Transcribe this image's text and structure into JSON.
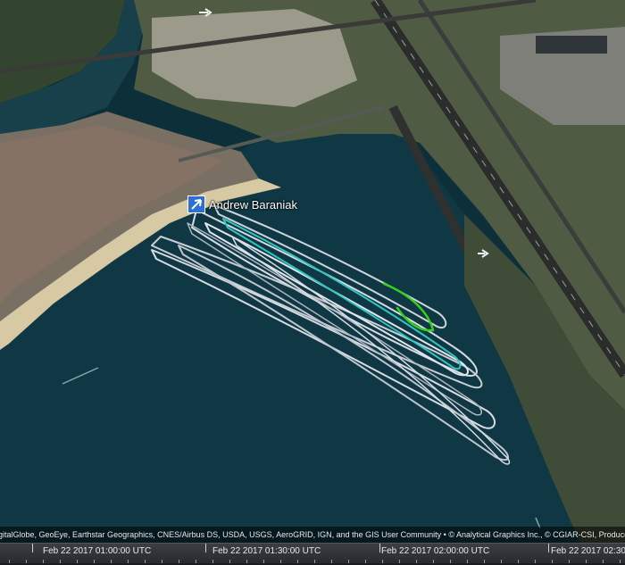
{
  "map": {
    "tracker": {
      "name": "Andrew Baraniak",
      "icon": "user-location-icon",
      "color": "#2d6fd4"
    },
    "track_colors": {
      "primary": "#d7dce3",
      "highlight_cyan": "#30c6c0",
      "highlight_green": "#33d21e"
    }
  },
  "credits": {
    "text": "igitalGlobe, GeoEye, Earthstar Geographics, CNES/Airbus DS, USDA, USGS, AeroGRID, IGN, and the GIS User Community • © Analytical Graphics Inc., © CGIAR-CSI, Produced using Copernicus data"
  },
  "timeline": {
    "labels": [
      "Feb 22 2017 01:00:00 UTC",
      "Feb 22 2017 01:30:00 UTC",
      "Feb 22 2017 02:00:00 UTC",
      "Feb 22 2017 02:30:0"
    ]
  }
}
